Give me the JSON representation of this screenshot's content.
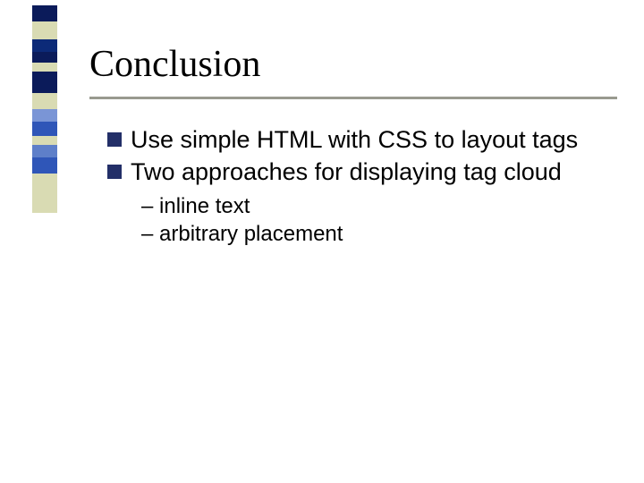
{
  "title": "Conclusion",
  "bullets": [
    {
      "text": "Use simple HTML with CSS to layout tags"
    },
    {
      "text": "Two approaches for displaying tag cloud"
    }
  ],
  "subbullets": [
    {
      "text": "– inline text"
    },
    {
      "text": "– arbitrary placement"
    }
  ],
  "decor_colors": [
    "#0b1b5a",
    "#d9dbb3",
    "#d9dbb3",
    "#0c2a78",
    "#0b1b5a",
    "#d9dbb3",
    "#0b1b5a",
    "#0b1b5a",
    "#d9dbb3",
    "#7a95d6",
    "#2f56b8",
    "#d9dbb3",
    "#5e7fc9",
    "#2f56b8",
    "#d9dbb3",
    "#d9dbb3"
  ],
  "decor_heights": [
    18,
    12,
    8,
    14,
    12,
    10,
    8,
    16,
    18,
    14,
    16,
    10,
    14,
    18,
    20,
    24
  ]
}
